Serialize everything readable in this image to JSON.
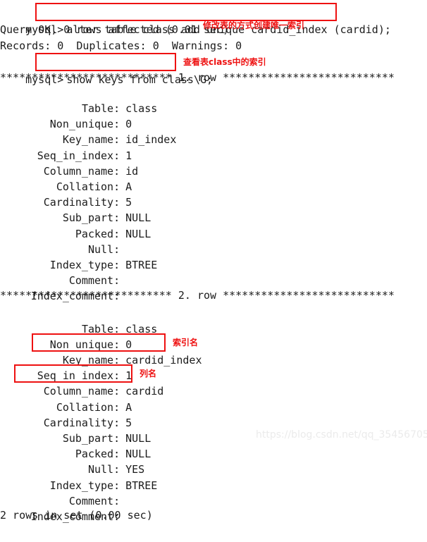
{
  "terminal": {
    "prompt": "mysql>",
    "colors": {
      "text": "#1b1b1b",
      "annotation": "#ee1111",
      "background": "#ffffff",
      "watermark": "#ebebeb"
    },
    "command1": "alter table class add unique cardid_index (cardid);",
    "result1_line1": "Query OK, 0 rows affected (0.01 sec)",
    "result1_line2": "Records: 0  Duplicates: 0  Warnings: 0",
    "command2": "show keys from class\\G;",
    "separator1": "*************************** 1. row ***************************",
    "separator2": "*************************** 2. row ***************************",
    "footer": "2 rows in set (0.00 sec)",
    "row1": [
      {
        "key": "Table:",
        "value": "class"
      },
      {
        "key": "Non_unique:",
        "value": "0"
      },
      {
        "key": "Key_name:",
        "value": "id_index"
      },
      {
        "key": "Seq_in_index:",
        "value": "1"
      },
      {
        "key": "Column_name:",
        "value": "id"
      },
      {
        "key": "Collation:",
        "value": "A"
      },
      {
        "key": "Cardinality:",
        "value": "5"
      },
      {
        "key": "Sub_part:",
        "value": "NULL"
      },
      {
        "key": "Packed:",
        "value": "NULL"
      },
      {
        "key": "Null:",
        "value": ""
      },
      {
        "key": "Index_type:",
        "value": "BTREE"
      },
      {
        "key": "Comment:",
        "value": ""
      },
      {
        "key": "Index_comment:",
        "value": ""
      }
    ],
    "row2": [
      {
        "key": "Table:",
        "value": "class"
      },
      {
        "key": "Non_unique:",
        "value": "0"
      },
      {
        "key": "Key_name:",
        "value": "cardid_index"
      },
      {
        "key": "Seq_in_index:",
        "value": "1"
      },
      {
        "key": "Column_name:",
        "value": "cardid"
      },
      {
        "key": "Collation:",
        "value": "A"
      },
      {
        "key": "Cardinality:",
        "value": "5"
      },
      {
        "key": "Sub_part:",
        "value": "NULL"
      },
      {
        "key": "Packed:",
        "value": "NULL"
      },
      {
        "key": "Null:",
        "value": "YES"
      },
      {
        "key": "Index_type:",
        "value": "BTREE"
      },
      {
        "key": "Comment:",
        "value": ""
      },
      {
        "key": "Index_comment:",
        "value": ""
      }
    ]
  },
  "annotations": {
    "note_create_unique_index": "修改表的方式创建唯一索引",
    "note_show_index": "查看表class中的索引",
    "note_index_name": "索引名",
    "note_column_name": "列名"
  },
  "watermark": {
    "text": "https://blog.csdn.net/qq_35456705"
  }
}
